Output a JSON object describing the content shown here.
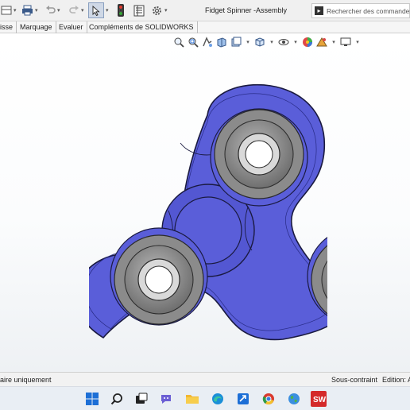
{
  "window": {
    "title": "Fidget Spinner -Assembly"
  },
  "search": {
    "placeholder": "Rechercher des commandes"
  },
  "tabs": [
    {
      "label": "isse"
    },
    {
      "label": "Marquage"
    },
    {
      "label": "Evaluer"
    },
    {
      "label": "Compléments de SOLIDWORKS"
    }
  ],
  "status": {
    "left": "aire uniquement",
    "constraint": "Sous-contraint",
    "edition": "Edition: A"
  },
  "model": {
    "body_color": "#5a5ed9",
    "bearing_color": "#8b8b8b"
  },
  "icons": {
    "toolbar": [
      "fit-icon",
      "print-icon",
      "undo-icon",
      "redo-icon",
      "select-arrow-icon",
      "traffic-light-icon",
      "file-properties-icon",
      "options-gear-icon"
    ],
    "heads_up": [
      "zoom-to-fit-icon",
      "zoom-area-icon",
      "previous-view-icon",
      "section-view-icon",
      "dynamic-annotation-icon",
      "view-orientation-icon",
      "display-style-icon",
      "hide-show-icon",
      "appearance-icon",
      "scene-icon",
      "view-settings-icon"
    ],
    "taskbar": [
      "windows-start-icon",
      "search-icon",
      "task-view-icon",
      "teams-chat-icon",
      "file-explorer-icon",
      "edge-icon",
      "office-icon",
      "chrome-icon",
      "earth-icon",
      "solidworks-icon"
    ]
  }
}
